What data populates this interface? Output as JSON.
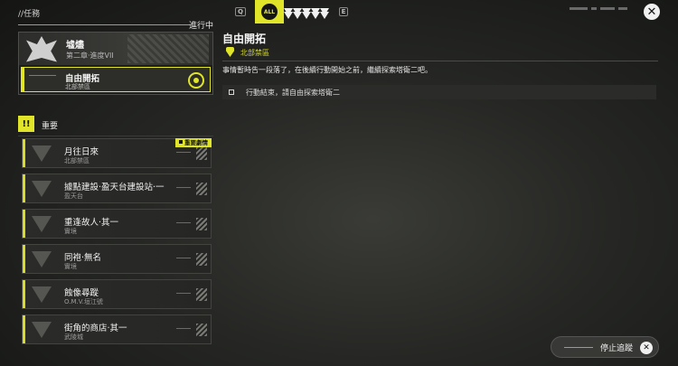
{
  "breadcrumb": "//任務",
  "filter_tabs": [
    {
      "label": "Q",
      "kind": "hint",
      "icon": "q-key-hint"
    },
    {
      "label": "ALL",
      "kind": "active",
      "icon": "all-filter-icon"
    },
    {
      "label": "",
      "kind": "tri",
      "icon": "main-story-filter-icon"
    },
    {
      "label": "",
      "kind": "tri",
      "icon": "side-story-filter-icon"
    },
    {
      "label": "",
      "kind": "tri",
      "icon": "exploration-filter-icon"
    },
    {
      "label": "",
      "kind": "tri",
      "icon": "daily-filter-icon"
    },
    {
      "label": "",
      "kind": "tri",
      "icon": "event-filter-icon"
    },
    {
      "label": "E",
      "kind": "hint",
      "icon": "e-key-hint"
    }
  ],
  "in_progress_label": "進行中",
  "group": {
    "title": "墟燼",
    "subtitle": "第二章‧進度VII",
    "selected_quest": {
      "title": "自由開拓",
      "location": "北部禁區"
    }
  },
  "section": {
    "badge": "!!",
    "title": "重要"
  },
  "quests": [
    {
      "title": "月往日來",
      "location": "北部禁區",
      "tag": "重要劇情"
    },
    {
      "title": "據點建設‧盈天台建設站‧一",
      "location": "盈天台",
      "tag": ""
    },
    {
      "title": "重逢故人‧其一",
      "location": "實境",
      "tag": ""
    },
    {
      "title": "同袍‧無名",
      "location": "實境",
      "tag": ""
    },
    {
      "title": "蝕像尋蹤",
      "location": "O.M.V.垣江號",
      "tag": ""
    },
    {
      "title": "街角的商店‧其一",
      "location": "武陵城",
      "tag": ""
    }
  ],
  "detail": {
    "title": "自由開拓",
    "location": "北部禁區",
    "description": "事情暫時告一段落了，在後續行動開始之前，繼續探索塔衛二吧。",
    "objective": "行動結束，請自由探索塔衛二"
  },
  "stop_tracking_label": "停止追蹤",
  "colors": {
    "accent": "#e0e52a",
    "background": "#262724"
  }
}
